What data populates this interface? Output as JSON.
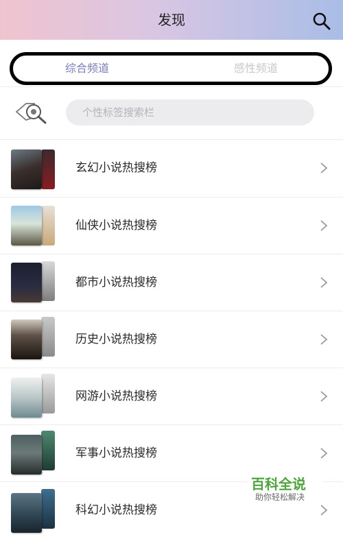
{
  "header": {
    "title": "发现",
    "search_icon": "search-icon"
  },
  "tabs": [
    {
      "label": "综合频道",
      "active": true
    },
    {
      "label": "感性频道",
      "active": false
    }
  ],
  "tag_search": {
    "icon": "tag-search-icon",
    "placeholder": "个性标签搜索栏"
  },
  "list": {
    "items": [
      {
        "label": "玄幻小说热搜榜"
      },
      {
        "label": "仙侠小说热搜榜"
      },
      {
        "label": "都市小说热搜榜"
      },
      {
        "label": "历史小说热搜榜"
      },
      {
        "label": "网游小说热搜榜"
      },
      {
        "label": "军事小说热搜榜"
      },
      {
        "label": "科幻小说热搜榜"
      }
    ]
  },
  "watermark": {
    "title": "百科全说",
    "subtitle": "助你轻松解决"
  },
  "colors": {
    "header_left": "#f0c4cf",
    "header_right": "#a9bde6",
    "active_tab": "#7a7fbc",
    "inactive_tab": "#c8c8c8",
    "watermark_green": "#4aa63b"
  }
}
